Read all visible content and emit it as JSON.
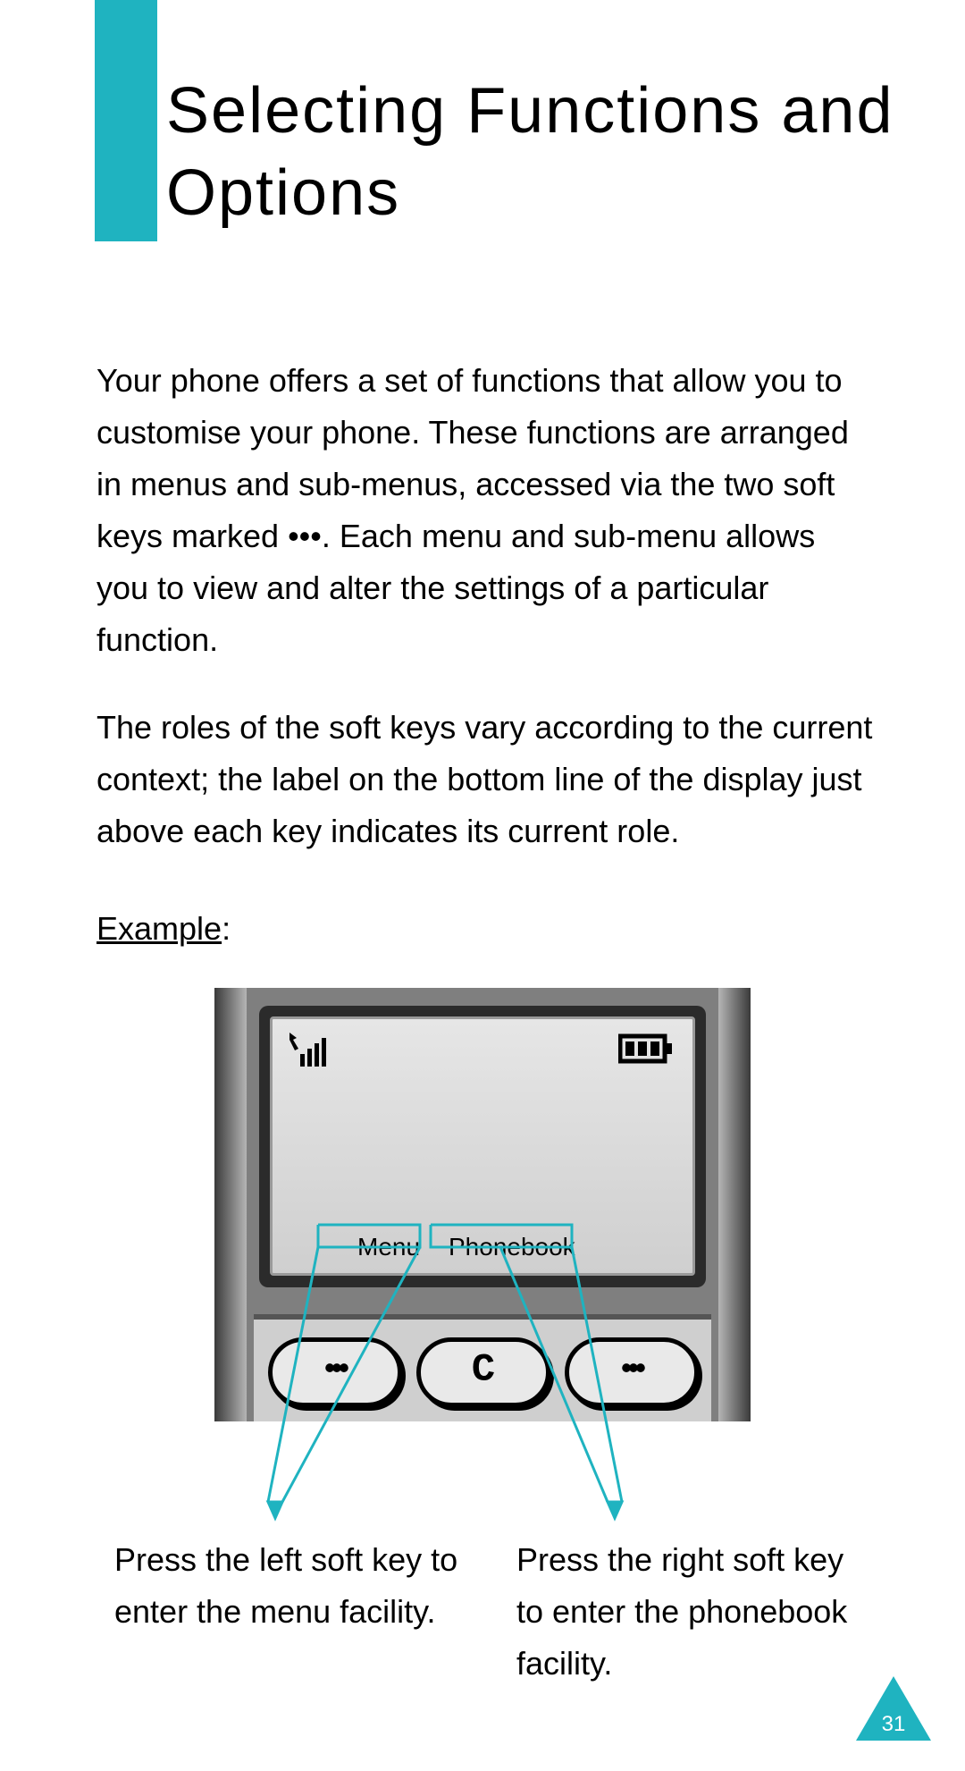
{
  "title": "Selecting Functions and Options",
  "para1_a": "Your phone offers a set of functions that allow you to customise your phone. These functions are arranged in menus and sub-menus, accessed via the two soft keys marked ",
  "softkey_marker": "•••",
  "para1_b": ". Each menu and sub-menu allows you to view and alter the settings of a particular function.",
  "para2": "The roles of the soft keys vary according to the current context; the label on the bottom line of the display just above each key indicates its current role.",
  "example_label": "Example",
  "phone": {
    "signal_icon": "signal-icon",
    "battery_icon": "battery-icon",
    "softkey_left": "Menu",
    "softkey_right": "Phonebook",
    "mid_key_glyph": "C"
  },
  "caption_left": "Press the left soft key to enter the menu facility.",
  "caption_right": "Press the right soft key to enter the phonebook facility.",
  "page_number": "31",
  "colors": {
    "accent": "#1fb3c0"
  }
}
